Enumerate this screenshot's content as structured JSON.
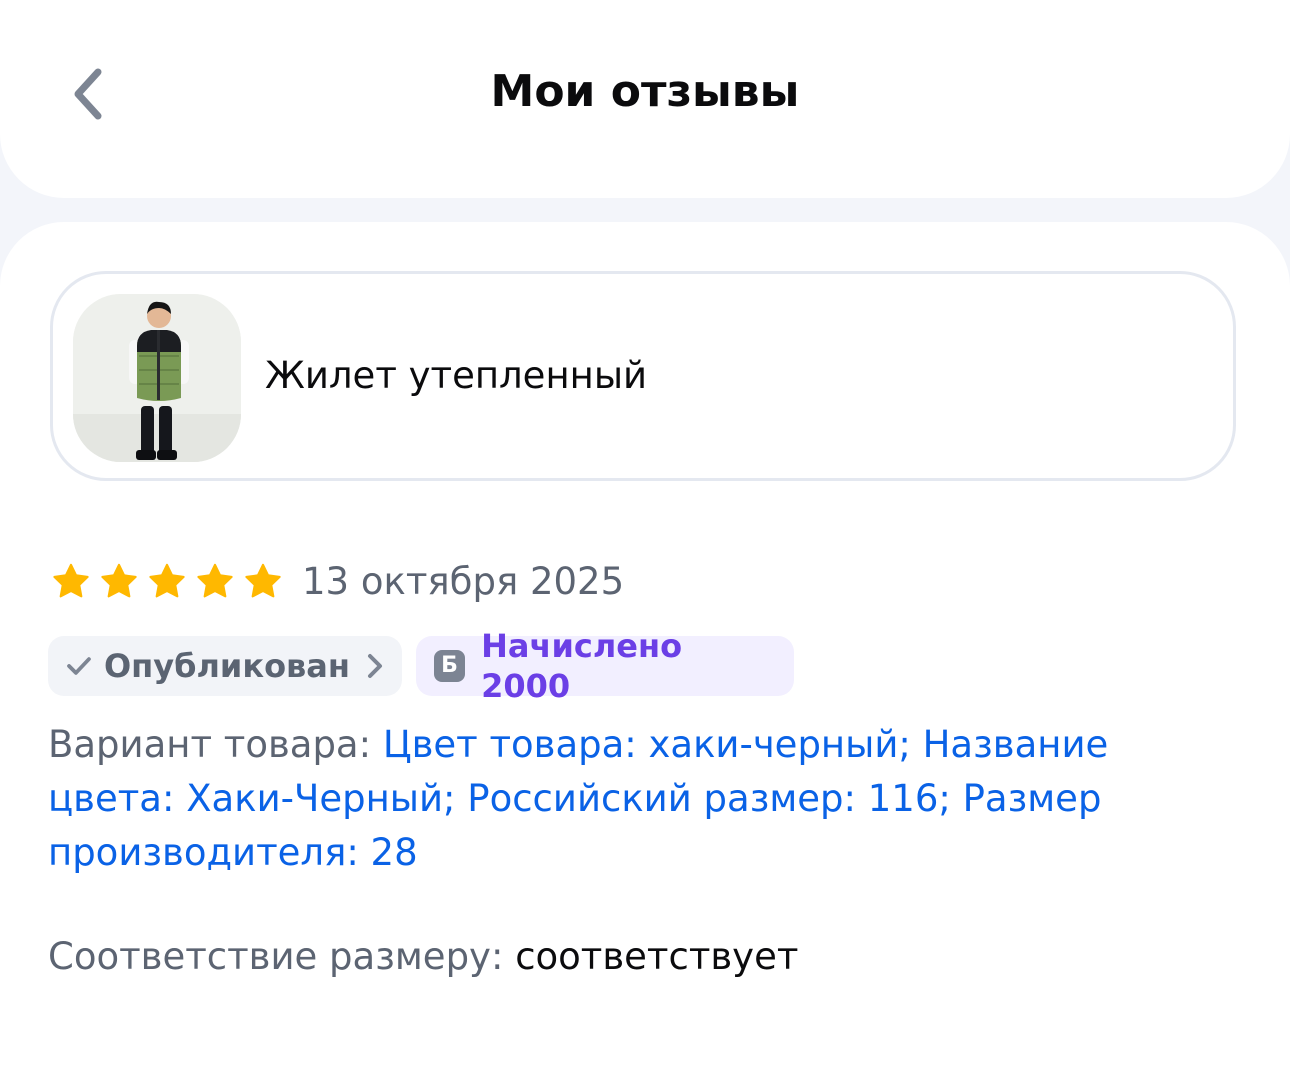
{
  "header": {
    "title": "Мои отзывы",
    "back_icon": "chevron-left-icon"
  },
  "product": {
    "name": "Жилет утепленный",
    "image": "product-photo-child-in-khaki-black-vest"
  },
  "review": {
    "rating": 5,
    "rating_max": 5,
    "star_color": "#ffb800",
    "date": "13 октября 2025",
    "status": {
      "icon": "check-icon",
      "label": "Опубликован",
      "chevron": "chevron-right-icon"
    },
    "bonus": {
      "icon_letter": "Б",
      "label": "Начислено 2000",
      "color": "#6b3fe6"
    },
    "variant": {
      "label": "Вариант товара:",
      "value": "Цвет товара: хаки-черный; Название цвета: Хаки-Черный; Российский размер: 116; Размер производителя: 28"
    },
    "size_fit": {
      "label": "Соответствие размеру:",
      "value": "соответствует"
    }
  },
  "colors": {
    "link": "#0a62e6",
    "muted": "#5c6472",
    "background": "#f3f5fa"
  }
}
